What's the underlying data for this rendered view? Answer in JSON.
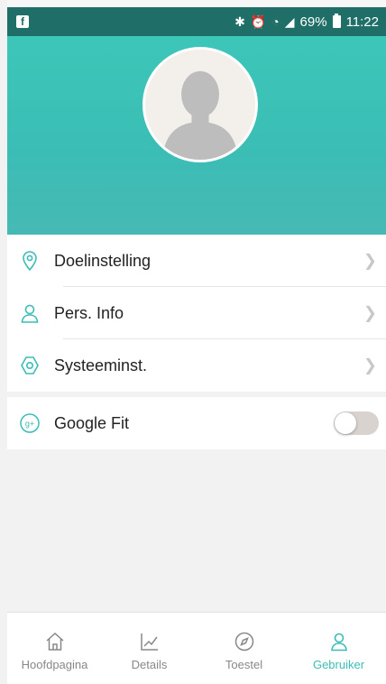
{
  "status_bar": {
    "app_icon": "facebook-icon",
    "battery": "69%",
    "time": "11:22"
  },
  "profile": {
    "avatar_icon": "default-avatar-icon"
  },
  "menu": {
    "items": [
      {
        "label": "Doelinstelling",
        "icon": "location-pin-icon"
      },
      {
        "label": "Pers. Info",
        "icon": "person-icon"
      },
      {
        "label": "Systeeminst.",
        "icon": "gear-icon"
      }
    ],
    "google_fit": {
      "label": "Google Fit",
      "icon": "google-plus-icon",
      "enabled": false
    }
  },
  "bottom_nav": {
    "items": [
      {
        "label": "Hoofdpagina",
        "icon": "home-icon",
        "active": false
      },
      {
        "label": "Details",
        "icon": "chart-icon",
        "active": false
      },
      {
        "label": "Toestel",
        "icon": "compass-icon",
        "active": false
      },
      {
        "label": "Gebruiker",
        "icon": "user-icon",
        "active": true
      }
    ]
  },
  "colors": {
    "accent": "#3bbdb5",
    "status_bar": "#1f6f68",
    "inactive": "#888888"
  }
}
